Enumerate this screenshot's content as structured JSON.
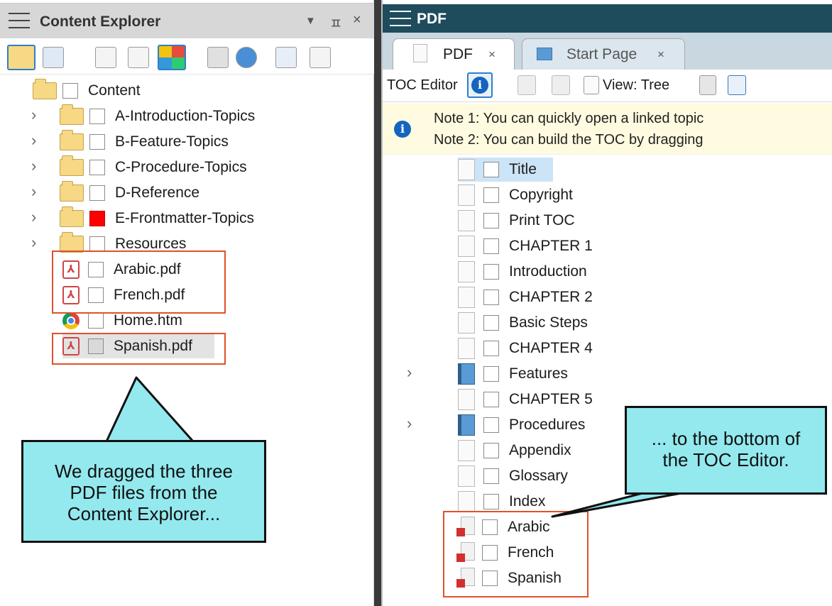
{
  "left_pane": {
    "title": "Content Explorer",
    "controls": [
      "▼",
      "ㅍ",
      "×"
    ],
    "tree": {
      "root": "Content",
      "folders": [
        "A-Introduction-Topics",
        "B-Feature-Topics",
        "C-Procedure-Topics",
        "D-Reference",
        "E-Frontmatter-Topics",
        "Resources"
      ],
      "files": [
        "Arabic.pdf",
        "French.pdf",
        "Home.htm",
        "Spanish.pdf"
      ]
    }
  },
  "right_pane": {
    "title": "PDF",
    "tabs": [
      {
        "label": "PDF",
        "close": "×"
      },
      {
        "label": "Start Page",
        "close": "×"
      }
    ],
    "toolbar": {
      "toc_editor": "TOC Editor",
      "view": "View: Tree"
    },
    "notes": [
      "Note 1: You can quickly open a linked topic",
      "Note 2: You can build the TOC by dragging"
    ],
    "toc_items": [
      "Title",
      "Copyright",
      "Print TOC",
      "CHAPTER 1",
      "Introduction",
      "CHAPTER 2",
      "Basic Steps",
      "CHAPTER 4",
      "Features",
      "CHAPTER 5",
      "Procedures",
      "Appendix",
      "Glossary",
      "Index",
      "Arabic",
      "French",
      "Spanish"
    ]
  },
  "callouts": {
    "left": "We dragged the three PDF files from the Content Explorer...",
    "right": "... to the bottom of the TOC Editor."
  },
  "colors": {
    "accent": "#2e7fc8",
    "pdf_title_bar": "#1e4c5c",
    "callout_fill": "#93e9ee",
    "highlight_box": "#e0512a"
  }
}
